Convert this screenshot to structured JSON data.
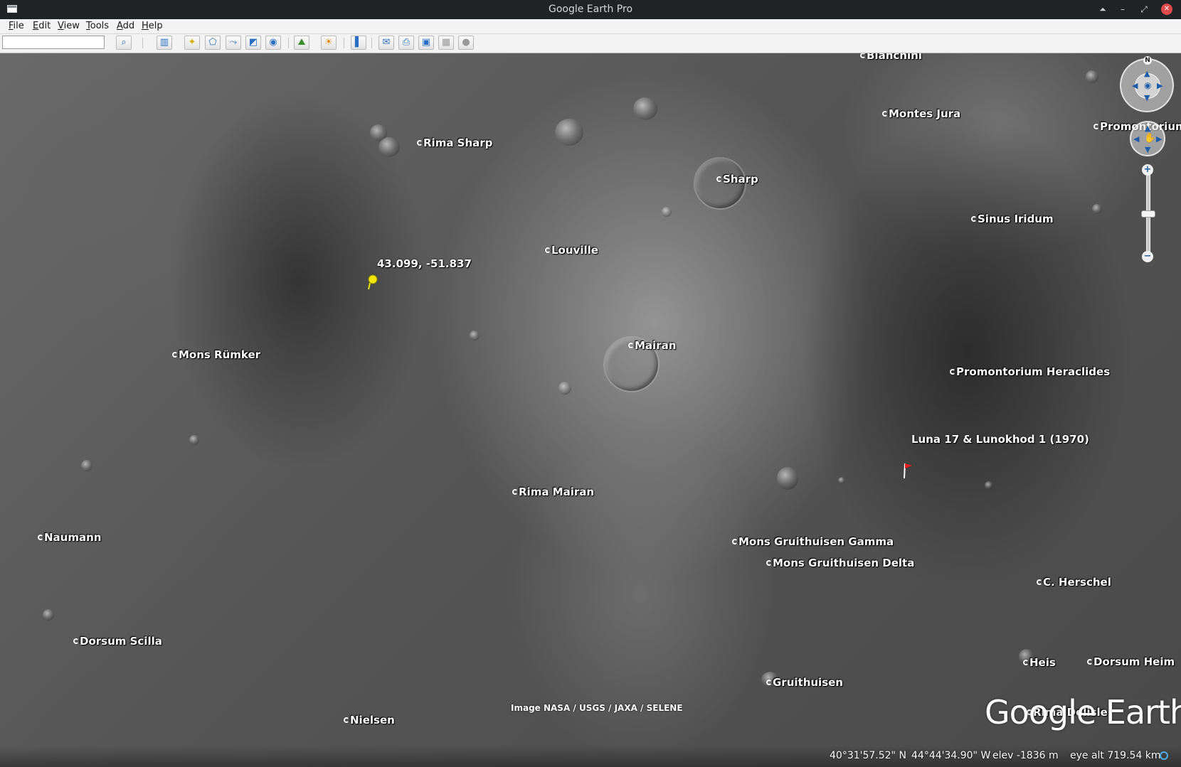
{
  "window": {
    "title": "Google Earth Pro"
  },
  "menu": [
    {
      "key": "F",
      "rest": "ile"
    },
    {
      "key": "E",
      "rest": "dit"
    },
    {
      "key": "V",
      "rest": "iew"
    },
    {
      "key": "T",
      "rest": "ools"
    },
    {
      "key": "A",
      "rest": "dd"
    },
    {
      "key": "H",
      "rest": "elp"
    }
  ],
  "search": {
    "value": ""
  },
  "toolbar_icons": [
    "sidebar-toggle-icon",
    "add-placemark-icon",
    "add-polygon-icon",
    "add-path-icon",
    "add-image-overlay-icon",
    "record-tour-icon",
    "historical-imagery-icon",
    "sunlight-icon",
    "switch-planet-icon",
    "ruler-icon",
    "email-icon",
    "print-icon",
    "save-image-icon",
    "view-in-maps-icon",
    "earth-mode-icon"
  ],
  "places": [
    {
      "name": "Bianchini"
    },
    {
      "name": "Montes Jura"
    },
    {
      "name": "Promontorium L"
    },
    {
      "name": "Rima Sharp"
    },
    {
      "name": "Sharp"
    },
    {
      "name": "Sinus Iridum"
    },
    {
      "name": "Louville"
    },
    {
      "name": "Mons Rümker"
    },
    {
      "name": "Mairan"
    },
    {
      "name": "Promontorium Heraclides"
    },
    {
      "name": "Rima Mairan"
    },
    {
      "name": "Naumann"
    },
    {
      "name": "Mons Gruithuisen Gamma"
    },
    {
      "name": "Mons Gruithuisen Delta"
    },
    {
      "name": "C. Herschel"
    },
    {
      "name": "Dorsum Scilla"
    },
    {
      "name": "Heis"
    },
    {
      "name": "Dorsum Heim"
    },
    {
      "name": "Gruithuisen"
    },
    {
      "name": "Nielsen"
    },
    {
      "name": "Rima Delisle"
    }
  ],
  "pushpin": {
    "label": "43.099, -51.837"
  },
  "flag": {
    "label": "Luna 17 & Lunokhod 1 (1970)"
  },
  "attribution": "Image NASA / USGS / JAXA / SELENE",
  "logo": "Google Earth",
  "status": {
    "lat": "40°31'57.52\" N",
    "lon": "44°44'34.90\" W",
    "elev": "elev -1836 m",
    "eye": "eye alt 719.54 km"
  },
  "nav": {
    "north_label": "N",
    "zoom_in": "+",
    "zoom_out": "−"
  }
}
